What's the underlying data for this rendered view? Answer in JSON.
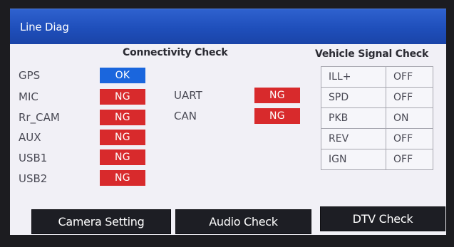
{
  "title": "Line Diag",
  "connectivity": {
    "heading": "Connectivity Check",
    "items": [
      {
        "label": "GPS",
        "status": "OK"
      },
      {
        "label": "MIC",
        "status": "NG"
      },
      {
        "label": "Rr_CAM",
        "status": "NG"
      },
      {
        "label": "AUX",
        "status": "NG"
      },
      {
        "label": "USB1",
        "status": "NG"
      },
      {
        "label": "USB2",
        "status": "NG"
      },
      {
        "label": "UART",
        "status": "NG"
      },
      {
        "label": "CAN",
        "status": "NG"
      }
    ]
  },
  "vehicle": {
    "heading": "Vehicle Signal Check",
    "signals": [
      {
        "name": "ILL+",
        "value": "OFF"
      },
      {
        "name": "SPD",
        "value": "OFF"
      },
      {
        "name": "PKB",
        "value": "ON"
      },
      {
        "name": "REV",
        "value": "OFF"
      },
      {
        "name": "IGN",
        "value": "OFF"
      }
    ]
  },
  "buttons": {
    "camera_setting": "Camera Setting",
    "audio_check": "Audio Check",
    "dtv_check": "DTV Check"
  },
  "colors": {
    "title_bar": "#2558c4",
    "status_ok": "#1a66dd",
    "status_ng": "#d82a2c",
    "button_bg": "#1d1e24"
  }
}
